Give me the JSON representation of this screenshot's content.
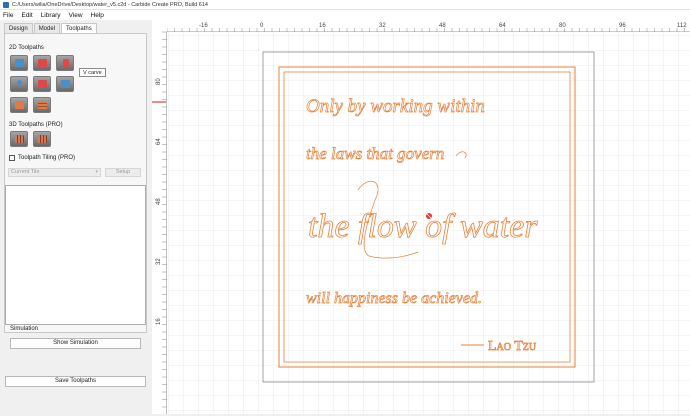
{
  "window": {
    "title": "C:/Users/wilia/OneDrive/Desktop/water_v5.c2d - Carbide Create PRO, Build 614"
  },
  "menu": [
    "File",
    "Edit",
    "Library",
    "View",
    "Help"
  ],
  "tabs": [
    "Design",
    "Model",
    "Toolpaths"
  ],
  "active_tab": "Toolpaths",
  "toolpaths2d": {
    "label": "2D Toolpaths",
    "tooltip": "V carve",
    "tools": [
      {
        "icon": "contour-toolpath-icon",
        "color": "#4a90c8"
      },
      {
        "icon": "pocket-toolpath-icon",
        "color": "#e04848"
      },
      {
        "icon": "vcarve-toolpath-icon",
        "color": "#e04848"
      },
      {
        "icon": "drill-toolpath-icon",
        "color": "#4a90c8"
      },
      {
        "icon": "advanced-vcarve-icon",
        "color": "#e04848"
      },
      {
        "icon": "texture-toolpath-icon",
        "color": "#4a90c8"
      },
      {
        "icon": "rough-toolpath-icon",
        "color": "#e07a48"
      },
      {
        "icon": "finish-toolpath-icon",
        "color": "#e07a48"
      }
    ]
  },
  "toolpaths3d": {
    "label": "3D Toolpaths (PRO)",
    "tools": [
      {
        "icon": "3d-rough-toolpath-icon",
        "color": "#d07a5a"
      },
      {
        "icon": "3d-finish-toolpath-icon",
        "color": "#d07a5a"
      }
    ]
  },
  "tiling": {
    "checkbox_label": "Toolpath Tiling (PRO)",
    "current_tile": "Current Tile",
    "setup": "Setup"
  },
  "simulation": {
    "label": "Simulation",
    "show_button": "Show Simulation"
  },
  "save_button": "Save Toolpaths",
  "rulers": {
    "top": [
      "-16",
      "0",
      "16",
      "32",
      "48",
      "64",
      "80",
      "96",
      "112"
    ],
    "left": [
      "80",
      "64",
      "48",
      "32",
      "16"
    ]
  },
  "design": {
    "line1": "Only by working within",
    "line2": "the laws that govern",
    "line3": "the flow of water",
    "line4": "will happiness be achieved.",
    "author": "Lao Tzu",
    "accent": "#e8823a"
  }
}
